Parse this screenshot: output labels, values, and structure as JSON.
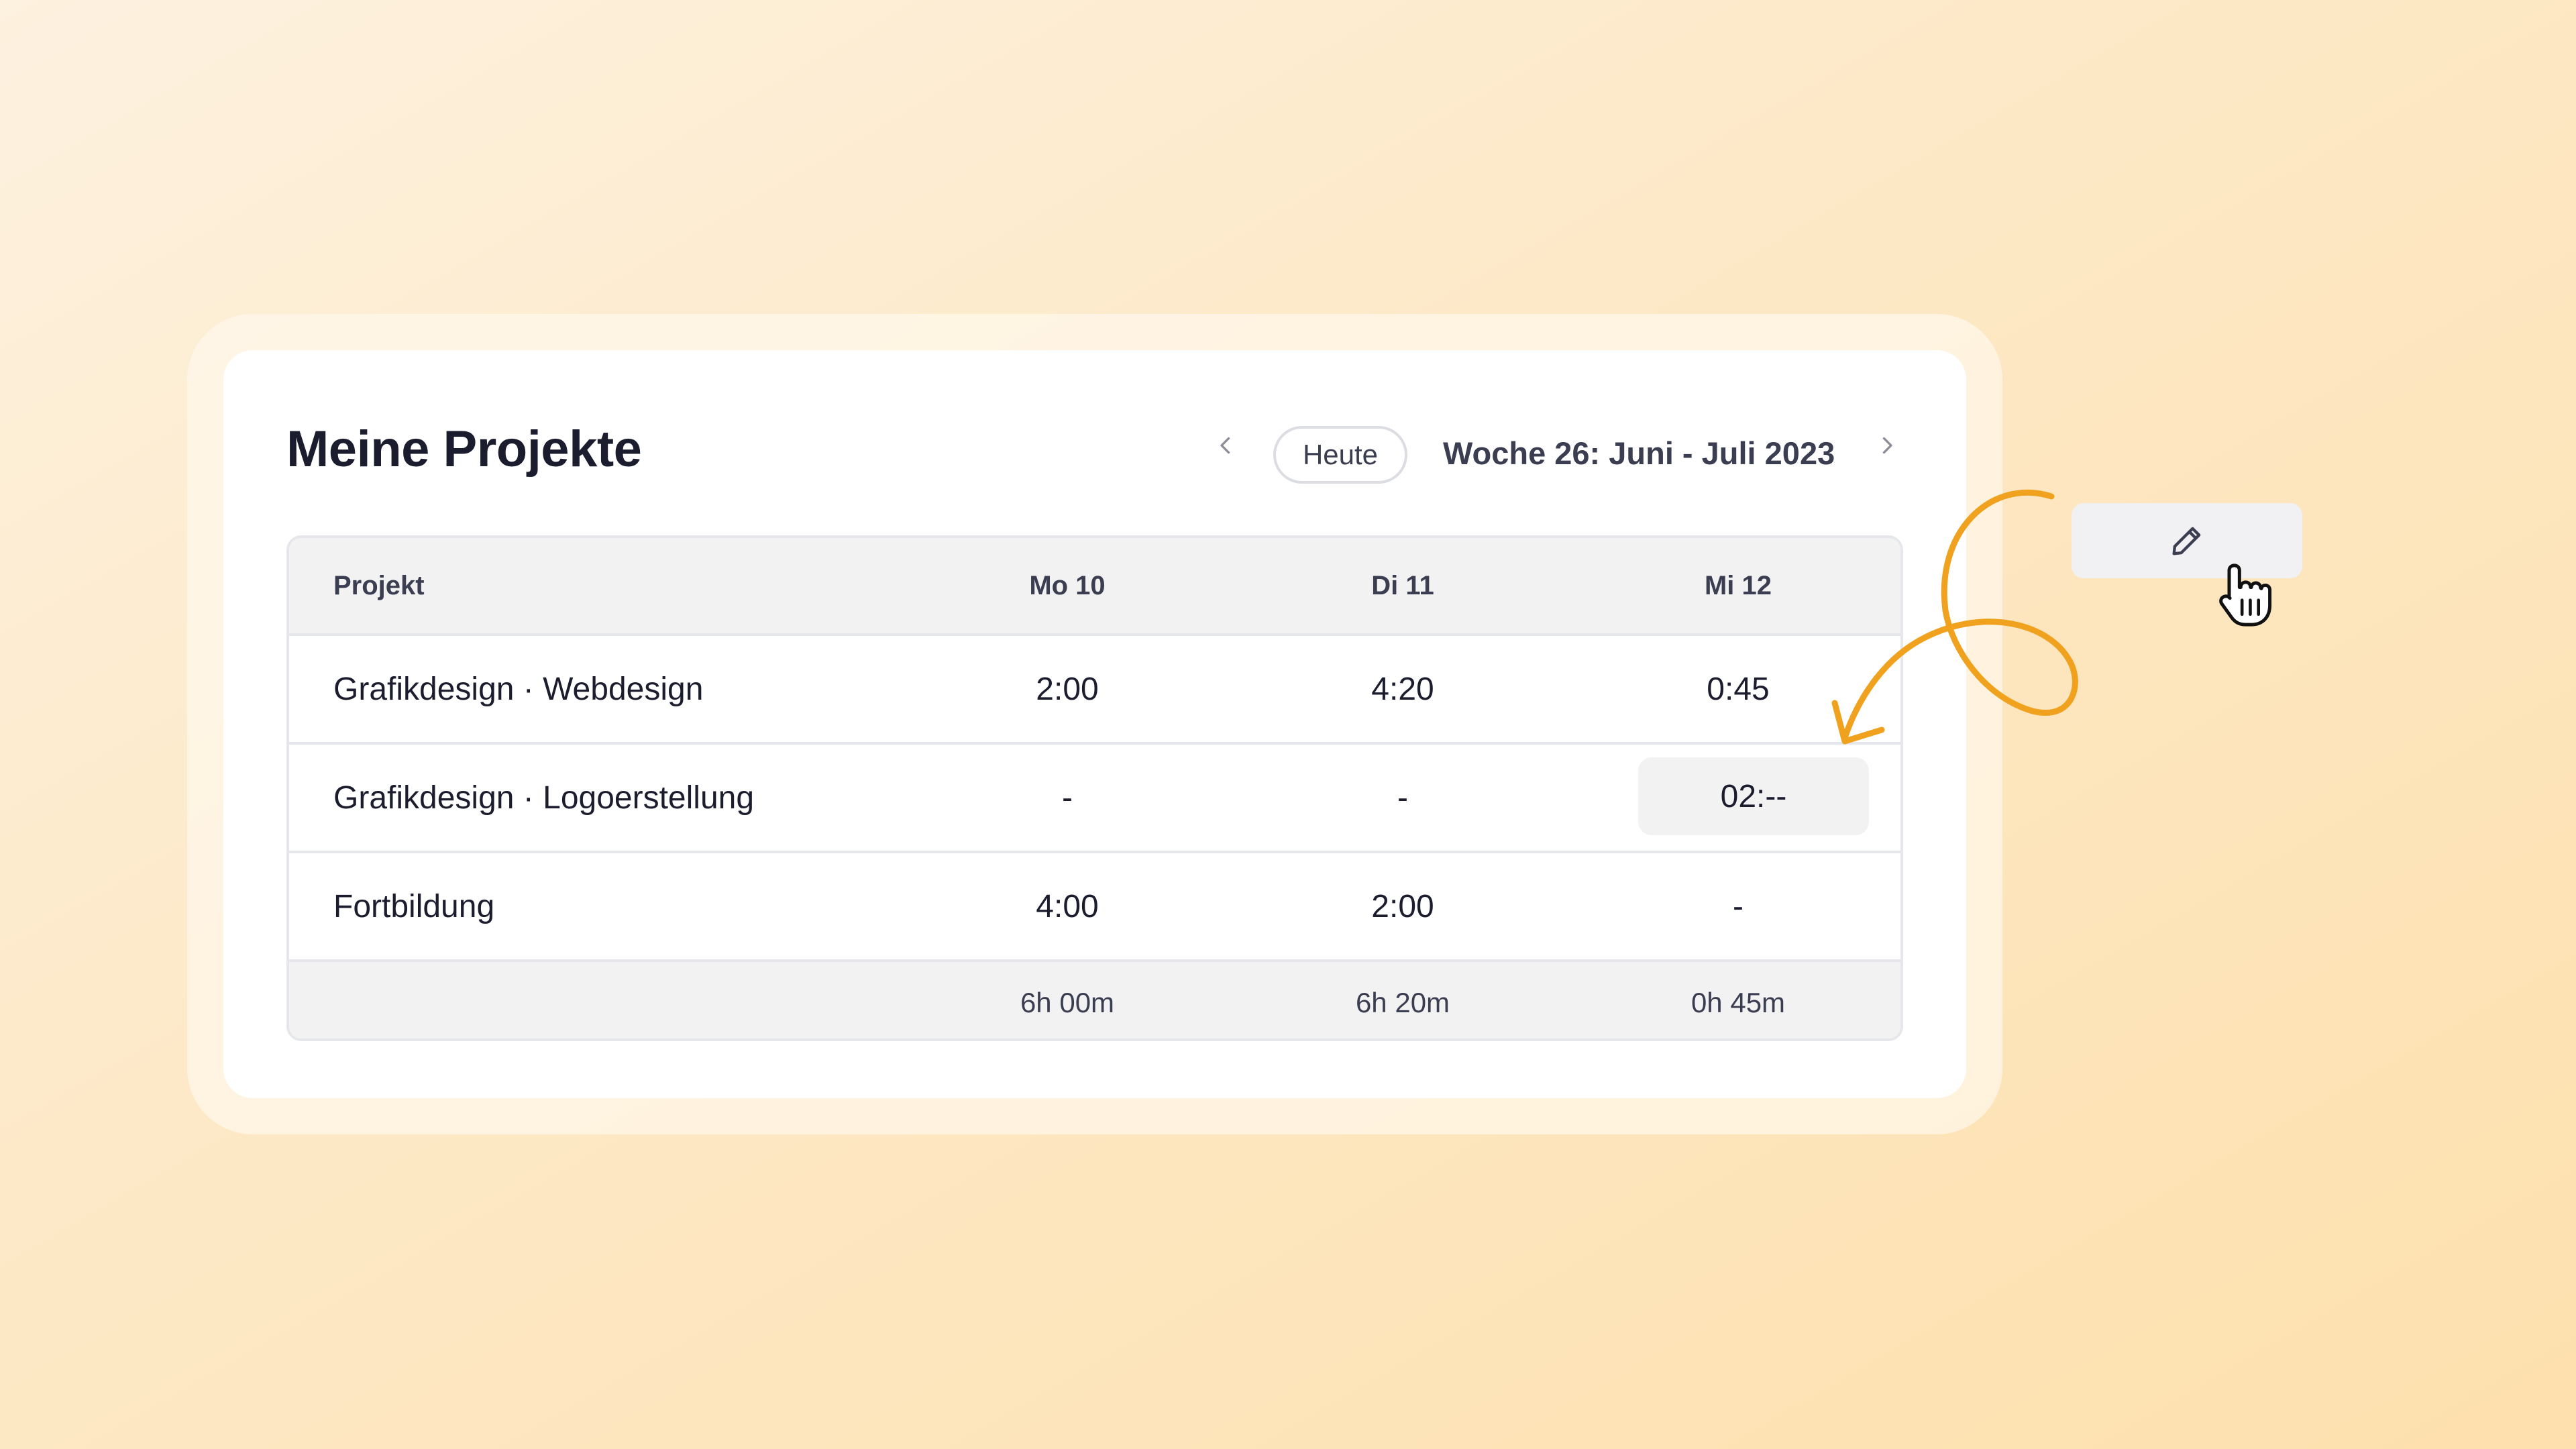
{
  "header": {
    "title": "Meine Projekte",
    "today_label": "Heute",
    "week_label": "Woche 26: Juni - Juli 2023",
    "prev_icon": "chevron-left-icon",
    "next_icon": "chevron-right-icon"
  },
  "table": {
    "columns": [
      "Projekt",
      "Mo 10",
      "Di 11",
      "Mi 12"
    ],
    "rows": [
      [
        "Grafikdesign · Webdesign",
        "2:00",
        "4:20",
        "0:45"
      ],
      [
        "Grafikdesign · Logoerstellung",
        "-",
        "-",
        "02:--"
      ],
      [
        "Fortbildung",
        "4:00",
        "2:00",
        "-"
      ]
    ],
    "totals": [
      "",
      "6h 00m",
      "6h 20m",
      "0h 45m"
    ]
  },
  "edit_button": {
    "icon": "pencil-icon"
  },
  "pointer": {
    "icon": "hand-cursor-icon"
  },
  "colors": {
    "accent": "#f0a21e",
    "text": "#1b1d2e",
    "muted_text": "#3b3e50",
    "table_header_bg": "#f2f2f3"
  }
}
